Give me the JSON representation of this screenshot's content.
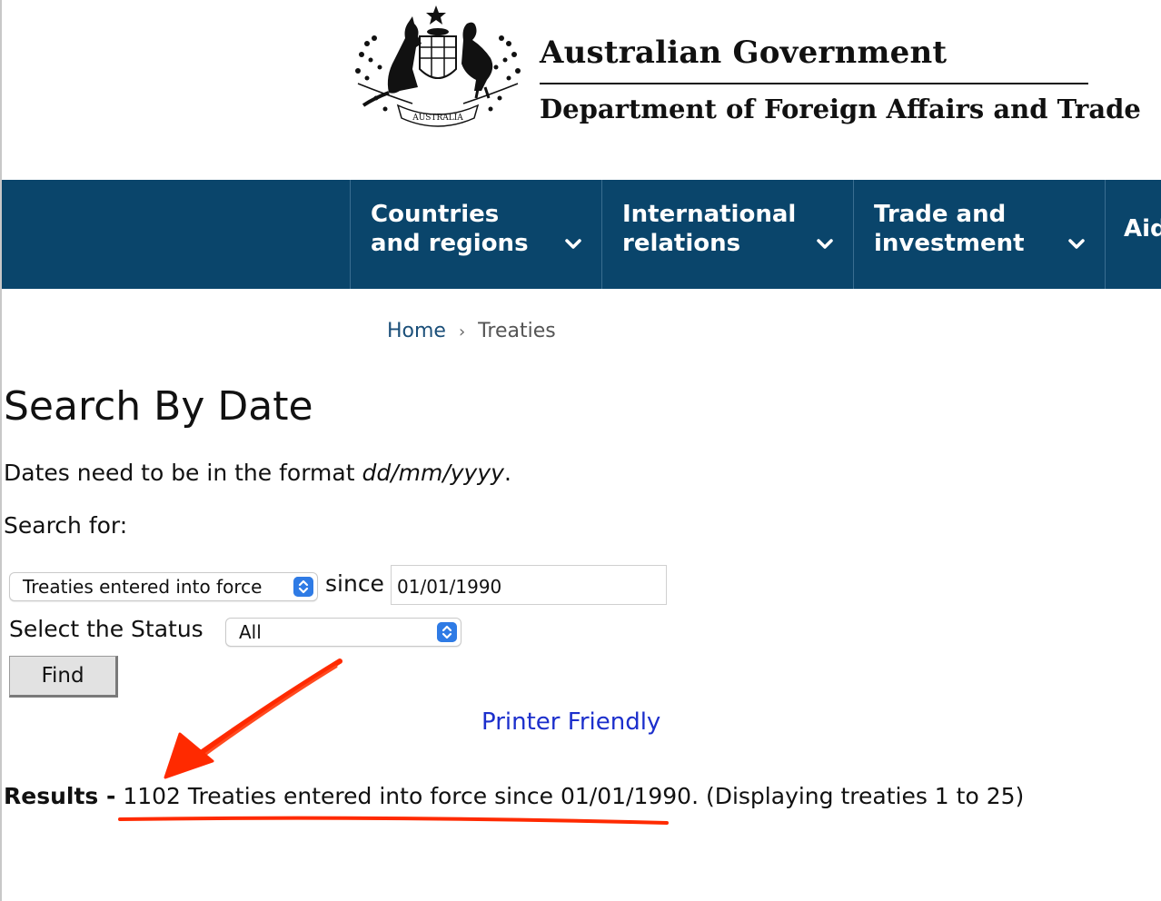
{
  "header": {
    "government_name": "Australian Government",
    "department_name": "Department of Foreign Affairs and Trade",
    "crest_text": "AUSTRALIA"
  },
  "nav": {
    "items": [
      {
        "label": "Countries and regions"
      },
      {
        "label": "International relations"
      },
      {
        "label": "Trade and investment"
      },
      {
        "label": "Aid"
      }
    ]
  },
  "breadcrumb": {
    "home": "Home",
    "separator": "›",
    "current": "Treaties"
  },
  "main": {
    "title": "Search By Date",
    "format_note_prefix": "Dates need to be in the format ",
    "format_note_format": "dd/mm/yyyy",
    "format_note_suffix": ".",
    "search_for_label": "Search for:",
    "search_type_selected": "Treaties entered into force",
    "since_label": "since",
    "date_value": "01/01/1990",
    "status_label": "Select the Status",
    "status_selected": "All",
    "find_label": "Find",
    "printer_friendly": "Printer Friendly",
    "results_label": "Results -",
    "results_text": " 1102 Treaties entered into force since 01/01/1990. (Displaying treaties 1 to 25)"
  },
  "colors": {
    "nav_background": "#0a456b",
    "link_blue": "#1c2fcc",
    "select_arrow_blue": "#2f7be5",
    "annotation_red": "#ff2a00"
  },
  "icons": {
    "crest": "coat-of-arms-icon",
    "nav_chevron": "chevron-down-icon",
    "select_arrows": "select-updown-icon"
  }
}
